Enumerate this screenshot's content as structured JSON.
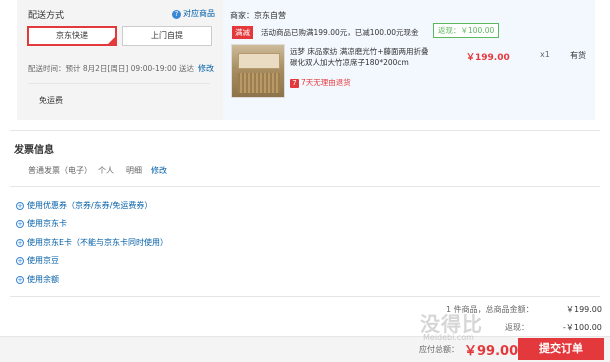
{
  "shipping": {
    "title": "配送方式",
    "match_goods": "对应商品",
    "options": [
      "京东快递",
      "上门自提"
    ],
    "delivery_time_label": "配送时间：预计 8月2日[周日] 09:00-19:00 送达",
    "edit": "修改",
    "free_shipping": "免运费"
  },
  "merchant": {
    "label": "商家：京东自营",
    "promo_tag": "满减",
    "promo_text": "活动商品已购满199.00元，已减100.00元现金",
    "discount_label": "返现：",
    "discount_value": "￥100.00"
  },
  "product": {
    "name": "远梦 床品家纺 满凉磨光竹+藤面两用折叠 碳化双人加大竹凉席子180*200cm",
    "price": "￥199.00",
    "qty": "x1",
    "stock": "有货",
    "return_badge": "7",
    "return_text": "7天无理由退货"
  },
  "invoice": {
    "title": "发票信息",
    "type": "普通发票（电子）",
    "holder": "个人",
    "content": "明细",
    "edit": "修改"
  },
  "coupons": [
    "使用优惠券（京券/东券/免运费券）",
    "使用京东卡",
    "使用京东E卡（不能与京东卡同时使用）",
    "使用京豆",
    "使用余额"
  ],
  "summary": {
    "items_label": "1 件商品，总商品金额：",
    "items_value": "￥199.00",
    "cashback_label": "返现：",
    "cashback_value": "-￥100.00",
    "total_label": "应付总额：",
    "total_value": "￥99.00",
    "submit": "提交订单"
  },
  "watermark": {
    "text": "没得比",
    "sub": "Meidebi.com"
  },
  "colors": {
    "accent": "#e4393c",
    "link": "#005ea7",
    "success": "#5cb85c"
  }
}
